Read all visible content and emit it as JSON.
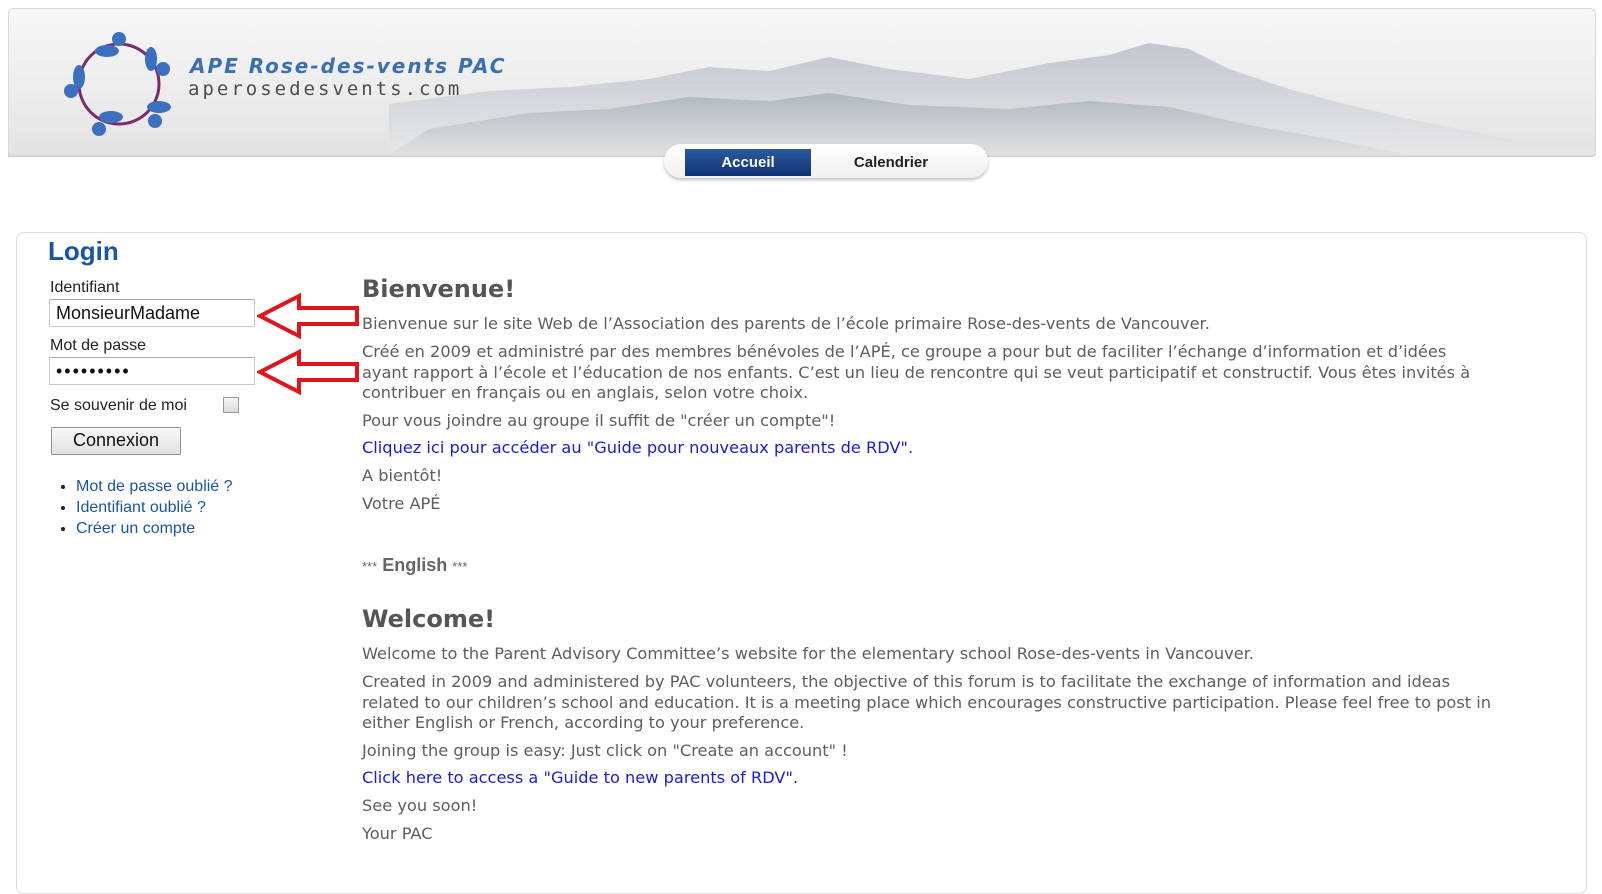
{
  "header": {
    "site_name": "APE Rose-des-vents PAC",
    "site_domain": "aperosedesvents.com"
  },
  "nav": {
    "tabs": [
      {
        "label": "Accueil",
        "active": true
      },
      {
        "label": "Calendrier",
        "active": false
      }
    ]
  },
  "login": {
    "title": "Login",
    "username_label": "Identifiant",
    "username_value": "MonsieurMadame",
    "password_label": "Mot de passe",
    "password_value": "•••••••••",
    "remember_label": "Se souvenir de moi",
    "remember_checked": false,
    "submit_label": "Connexion",
    "links": [
      "Mot de passe oublié ?",
      "Identifiant oublié ?",
      "Créer un compte"
    ]
  },
  "content": {
    "fr_title": "Bienvenue!",
    "fr_p1": "Bienvenue sur le site Web de l’Association des parents de l’école primaire Rose-des-vents de Vancouver.",
    "fr_p2": "Créé en 2009 et administré par des membres bénévoles de l’APÉ, ce groupe a pour but de faciliter l’échange d’information et d’idées ayant rapport à l’école et l’éducation de nos enfants. C’est un lieu de rencontre qui se veut participatif et constructif. Vous êtes invités à contribuer en français ou en anglais, selon votre choix.",
    "fr_p3": "Pour vous joindre au groupe il suffit de \"créer un compte\"!",
    "fr_link": "Cliquez ici pour accéder au \"Guide pour nouveaux parents de RDV\".",
    "fr_p4": "A bientôt!",
    "fr_p5": "Votre APÉ",
    "english_marker_pre": "***",
    "english_marker": "English",
    "english_marker_post": "***",
    "en_title": "Welcome!",
    "en_p1": "Welcome to the Parent Advisory Committee’s website for the elementary school Rose-des-vents in Vancouver.",
    "en_p2": "Created in 2009 and administered by PAC volunteers, the objective of this forum is to facilitate the exchange of information and ideas related to our children’s school and education. It is a meeting place which encourages constructive participation. Please feel free to post in either English or French, according to your preference.",
    "en_p3": "Joining the group is easy:  Just click on \"Create an account\" !",
    "en_link": "Click here to access a \"Guide to new parents of RDV\".",
    "en_p4": "See you soon!",
    "en_p5": "Your PAC"
  },
  "colors": {
    "accent": "#1a55a3",
    "tab_active": "#15397c",
    "link": "#1b1bd6",
    "arrow": "#e0141a"
  }
}
